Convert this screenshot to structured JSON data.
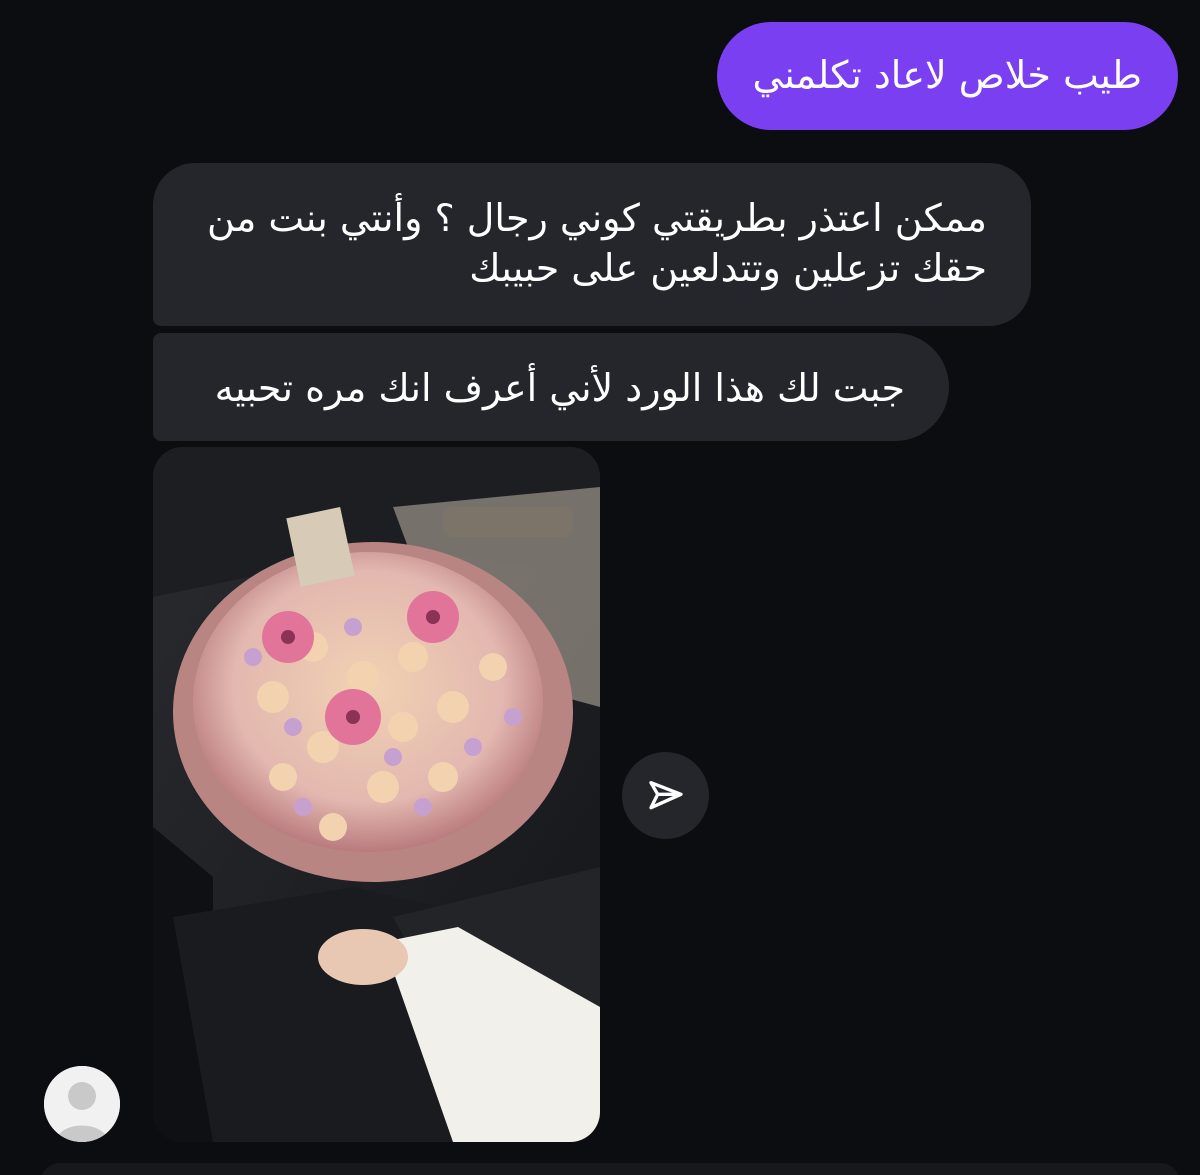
{
  "messages": {
    "outgoing_1": "طيب خلاص لاعاد تكلمني",
    "incoming_1_line_1": "ممكن اعتذر بطريقتي كوني رجال ؟ وأنتي بنت من",
    "incoming_1_line_2": "حقك تزعلين وتتدلعين على حبيبك",
    "incoming_2": "جبت لك هذا الورد لأني أعرف انك مره تحبيه"
  },
  "icons": {
    "share": "paper-plane-icon",
    "avatar": "default-user-avatar-icon"
  },
  "colors": {
    "background": "#0c0d11",
    "outgoing_bubble": "#7b3ff2",
    "incoming_bubble": "#25262b",
    "text": "#ffffff"
  }
}
